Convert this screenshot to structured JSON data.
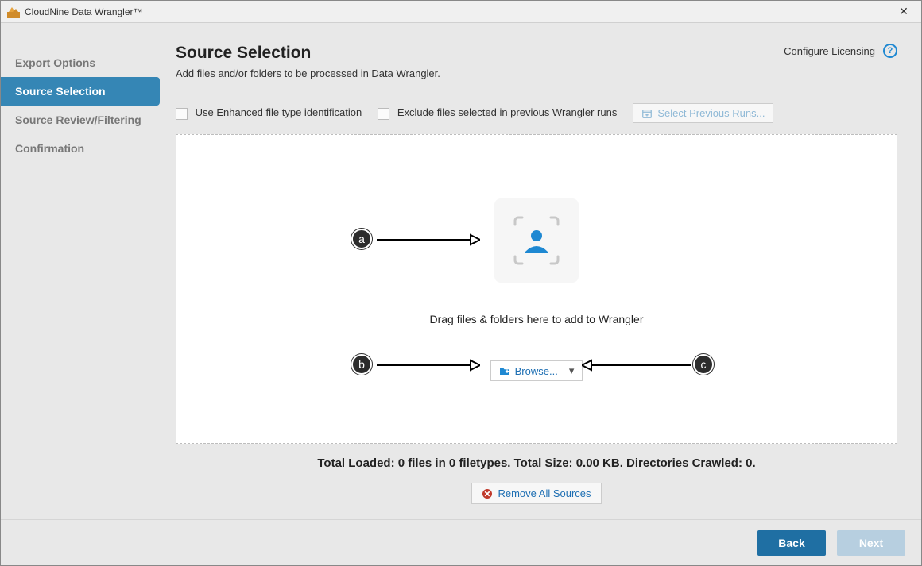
{
  "window": {
    "title": "CloudNine Data Wrangler™",
    "close_glyph": "✕"
  },
  "sidebar": {
    "items": [
      {
        "label": "Export Options",
        "active": false
      },
      {
        "label": "Source Selection",
        "active": true
      },
      {
        "label": "Source Review/Filtering",
        "active": false
      },
      {
        "label": "Confirmation",
        "active": false
      }
    ]
  },
  "header": {
    "title": "Source Selection",
    "subtitle": "Add files and/or folders to be processed in Data Wrangler.",
    "configure_label": "Configure Licensing",
    "help_glyph": "?"
  },
  "options": {
    "enhanced_label": "Use Enhanced file type identification",
    "exclude_label": "Exclude files selected in previous Wrangler runs",
    "select_prev_label": "Select Previous Runs..."
  },
  "dropzone": {
    "hint": "Drag files & folders here to add to Wrangler",
    "browse_label": "Browse...",
    "caret": "▾"
  },
  "annotations": {
    "a": "a",
    "b": "b",
    "c": "c"
  },
  "status": {
    "line": "Total Loaded: 0 files in 0 filetypes. Total Size: 0.00 KB. Directories Crawled: 0."
  },
  "remove": {
    "label": "Remove All Sources"
  },
  "footer": {
    "back": "Back",
    "next": "Next"
  }
}
